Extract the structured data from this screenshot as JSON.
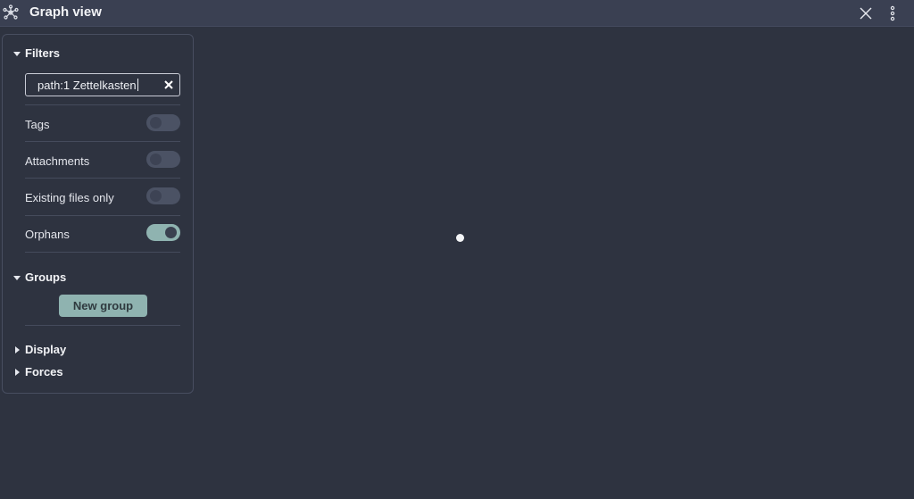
{
  "window": {
    "title": "Graph view",
    "icons": {
      "app": "graph-icon",
      "close": "close-icon",
      "more": "more-options-icon"
    }
  },
  "filters": {
    "header": "Filters",
    "search": {
      "value": "path:1 Zettelkasten",
      "placeholder": ""
    },
    "toggles": [
      {
        "label": "Tags",
        "on": false
      },
      {
        "label": "Attachments",
        "on": false
      },
      {
        "label": "Existing files only",
        "on": false
      },
      {
        "label": "Orphans",
        "on": true
      }
    ]
  },
  "groups": {
    "header": "Groups",
    "new_group_label": "New group"
  },
  "display": {
    "header": "Display"
  },
  "forces": {
    "header": "Forces"
  },
  "colors": {
    "background": "#2e3340",
    "accent": "#8fb3b0",
    "titlebar": "#3a4052"
  }
}
